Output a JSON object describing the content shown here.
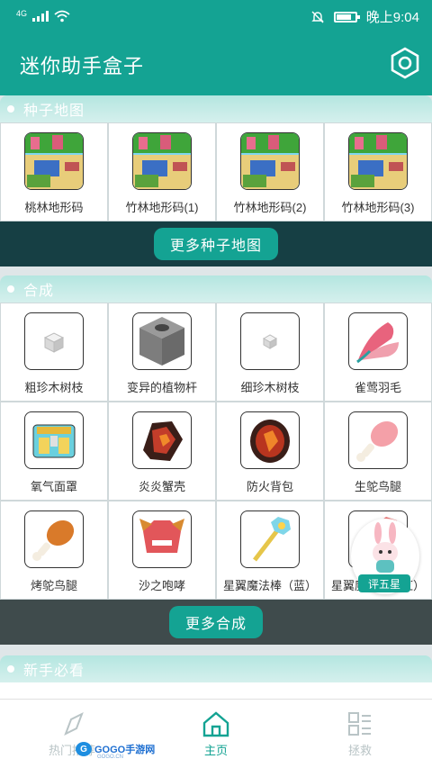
{
  "status_bar": {
    "network": "4G",
    "time": "晚上9:04"
  },
  "header": {
    "title": "迷你助手盒子",
    "settings_icon": "hexagon-gear-icon"
  },
  "seed_maps": {
    "title": "种子地图",
    "items": [
      {
        "label": "桃林地形码",
        "icon": "map-thumb-icon"
      },
      {
        "label": "竹林地形码(1)",
        "icon": "map-thumb-icon"
      },
      {
        "label": "竹林地形码(2)",
        "icon": "map-thumb-icon"
      },
      {
        "label": "竹林地形码(3)",
        "icon": "map-thumb-icon"
      }
    ],
    "more_label": "更多种子地图"
  },
  "crafting": {
    "title": "合成",
    "items": [
      {
        "label": "粗珍木树枝",
        "icon": "small-cube-icon"
      },
      {
        "label": "变异的植物杆",
        "icon": "stone-block-icon"
      },
      {
        "label": "细珍木树枝",
        "icon": "tiny-cube-icon"
      },
      {
        "label": "雀莺羽毛",
        "icon": "feather-icon"
      },
      {
        "label": "氧气面罩",
        "icon": "oxygen-mask-icon"
      },
      {
        "label": "炎炎蟹壳",
        "icon": "crab-shell-icon"
      },
      {
        "label": "防火背包",
        "icon": "fireproof-backpack-icon"
      },
      {
        "label": "生鸵鸟腿",
        "icon": "raw-drumstick-icon"
      },
      {
        "label": "烤鸵鸟腿",
        "icon": "roasted-drumstick-icon"
      },
      {
        "label": "沙之咆哮",
        "icon": "sand-roar-icon"
      },
      {
        "label": "星翼魔法棒（蓝）",
        "icon": "magic-wand-icon"
      },
      {
        "label": "星翼魔法棒（红）",
        "icon": "magic-wand-icon"
      }
    ],
    "more_label": "更多合成"
  },
  "newbie": {
    "title": "新手必看"
  },
  "rate_badge": {
    "label": "评五星"
  },
  "bottom_nav": [
    {
      "label": "热门推荐",
      "icon": "compass-icon",
      "active": false
    },
    {
      "label": "主页",
      "icon": "home-icon",
      "active": true
    },
    {
      "label": "拯救",
      "icon": "grid-icon",
      "active": false
    }
  ],
  "watermark": {
    "brand": "GOGO手游网",
    "site": "GOGO.CN"
  },
  "colors": {
    "brand": "#14a393",
    "dark_strip": "#163f44",
    "gray_strip": "#3f4b4c"
  }
}
